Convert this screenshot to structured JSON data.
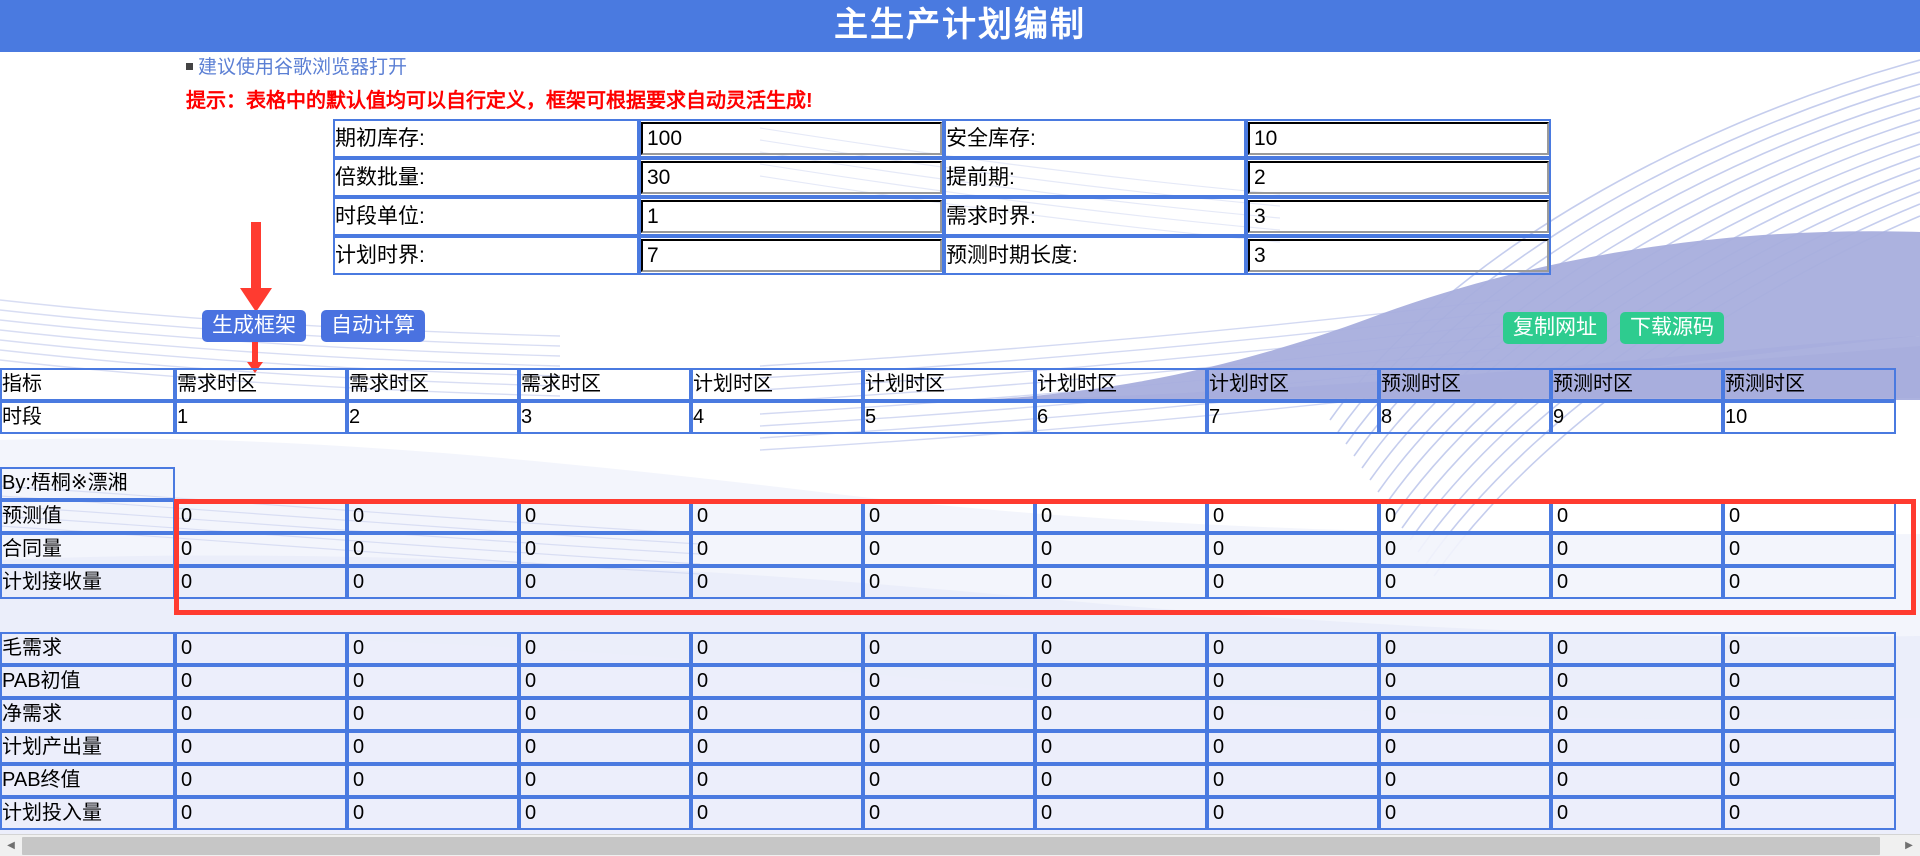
{
  "header": {
    "title": "主生产计划编制",
    "bar_color": "#4a7ae0"
  },
  "notices": {
    "browser_hint": "建议使用谷歌浏览器打开",
    "tip": "提示：表格中的默认值均可以自行定义，框架可根据要求自动灵活生成!",
    "tip_color": "#ff0000"
  },
  "params": [
    {
      "label_left": "期初库存:",
      "value_left": "100",
      "label_right": "安全库存:",
      "value_right": "10"
    },
    {
      "label_left": "倍数批量:",
      "value_left": "30",
      "label_right": "提前期:",
      "value_right": "2"
    },
    {
      "label_left": "时段单位:",
      "value_left": "1",
      "label_right": "需求时界:",
      "value_right": "3"
    },
    {
      "label_left": "计划时界:",
      "value_left": "7",
      "label_right": "预测时期长度:",
      "value_right": "3"
    }
  ],
  "buttons": {
    "generate": "生成框架",
    "autocalc": "自动计算",
    "copy_url": "复制网址",
    "download": "下载源码",
    "blue_color": "#4a72e0",
    "green_color": "#2ecc8f"
  },
  "grid": {
    "header_row_label": "指标",
    "period_row_label": "时段",
    "zones": [
      "需求时区",
      "需求时区",
      "需求时区",
      "计划时区",
      "计划时区",
      "计划时区",
      "计划时区",
      "预测时区",
      "预测时区",
      "预测时区"
    ],
    "periods": [
      "1",
      "2",
      "3",
      "4",
      "5",
      "6",
      "7",
      "8",
      "9",
      "10"
    ],
    "byline": "By:梧桐※漂湘",
    "input_rows": [
      {
        "label": "预测值",
        "values": [
          "0",
          "0",
          "0",
          "0",
          "0",
          "0",
          "0",
          "0",
          "0",
          "0"
        ]
      },
      {
        "label": "合同量",
        "values": [
          "0",
          "0",
          "0",
          "0",
          "0",
          "0",
          "0",
          "0",
          "0",
          "0"
        ]
      },
      {
        "label": "计划接收量",
        "values": [
          "0",
          "0",
          "0",
          "0",
          "0",
          "0",
          "0",
          "0",
          "0",
          "0"
        ]
      }
    ],
    "calc_rows": [
      {
        "label": "毛需求",
        "values": [
          "0",
          "0",
          "0",
          "0",
          "0",
          "0",
          "0",
          "0",
          "0",
          "0"
        ]
      },
      {
        "label": "PAB初值",
        "values": [
          "0",
          "0",
          "0",
          "0",
          "0",
          "0",
          "0",
          "0",
          "0",
          "0"
        ]
      },
      {
        "label": "净需求",
        "values": [
          "0",
          "0",
          "0",
          "0",
          "0",
          "0",
          "0",
          "0",
          "0",
          "0"
        ]
      },
      {
        "label": "计划产出量",
        "values": [
          "0",
          "0",
          "0",
          "0",
          "0",
          "0",
          "0",
          "0",
          "0",
          "0"
        ]
      },
      {
        "label": "PAB终值",
        "values": [
          "0",
          "0",
          "0",
          "0",
          "0",
          "0",
          "0",
          "0",
          "0",
          "0"
        ]
      },
      {
        "label": "计划投入量",
        "values": [
          "0",
          "0",
          "0",
          "0",
          "0",
          "0",
          "0",
          "0",
          "0",
          "0"
        ]
      }
    ],
    "highlight_color": "#ff3b30"
  }
}
